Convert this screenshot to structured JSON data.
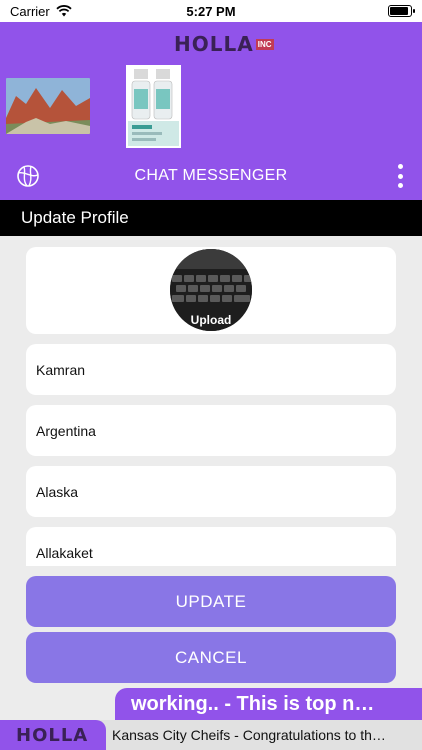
{
  "status_bar": {
    "carrier": "Carrier",
    "time": "5:27 PM",
    "battery_level": 0.9
  },
  "header": {
    "logo_text": "HOLLA",
    "logo_suffix": "INC",
    "title": "CHAT MESSENGER",
    "icons": {
      "left": "globe-icon",
      "right": "more-vertical-icon"
    },
    "brand_color": "#9153ea"
  },
  "section": {
    "title": "Update Profile"
  },
  "profile": {
    "upload_label": "Upload",
    "fields": [
      "Kamran",
      "Argentina",
      "Alaska",
      "Allakaket"
    ]
  },
  "buttons": {
    "update": "UPDATE",
    "cancel": "CANCEL",
    "color": "#8976e6"
  },
  "ticker": {
    "headline": "working.. - This is top n…",
    "logo_text": "HOLLA",
    "news": "Kansas City Cheifs - Congratulations to th…"
  }
}
